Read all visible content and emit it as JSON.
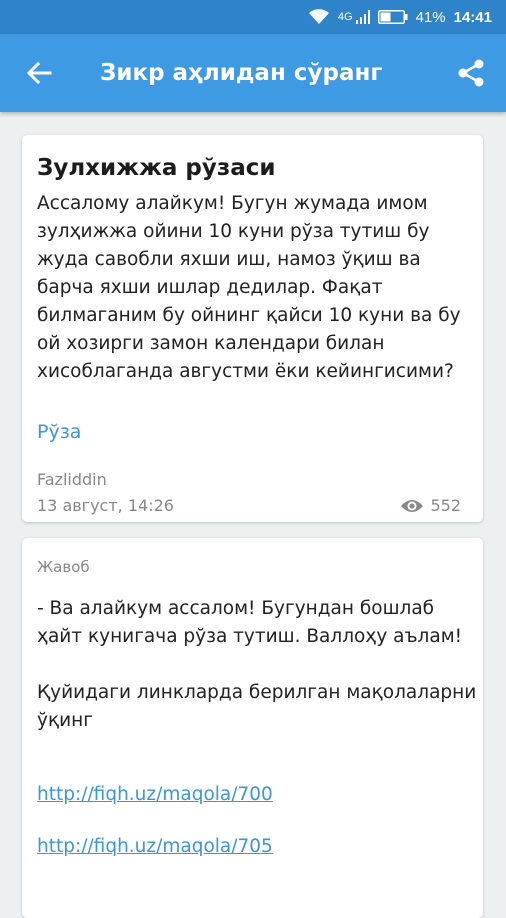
{
  "status": {
    "network": "4G",
    "battery": "41%",
    "time": "14:41"
  },
  "appbar": {
    "title": "Зикр аҳлидан сўранг"
  },
  "question": {
    "title": "Зулхижжа рўзаси",
    "body": "Ассалому алайкум! Бугун жумада имом зулҳижжа ойини 10 куни рўза тутиш бу жуда савобли яхши иш, намоз ўқиш ва барча яхши ишлар дедилар. Фақат билмаганим бу ойнинг қайси 10 куни ва бу ой хозирги замон календари билан хисоблаганда августми ёки кейингисими?",
    "tag": "Рўза",
    "author": "Fazliddin",
    "date": "13 август, 14:26",
    "views": "552"
  },
  "answer": {
    "label": "Жавоб",
    "para1": "- Ва алайкум ассалом! Бугундан бошлаб ҳайт кунигача рўза тутиш. Валлоҳу аълам!",
    "para2": "Қуйидаги линкларда берилган мақолаларни ўқинг",
    "links": [
      "http://fiqh.uz/maqola/700",
      "http://fiqh.uz/maqola/705"
    ]
  },
  "colors": {
    "statusbar": "#2f84c9",
    "appbar": "#3e9be3",
    "link": "#3b96d8",
    "background": "#ecf0f1"
  },
  "icons": {
    "back": "arrow-left-icon",
    "share": "share-icon",
    "views": "eye-icon",
    "wifi": "wifi-icon",
    "signal": "signal-icon",
    "battery": "battery-icon"
  }
}
